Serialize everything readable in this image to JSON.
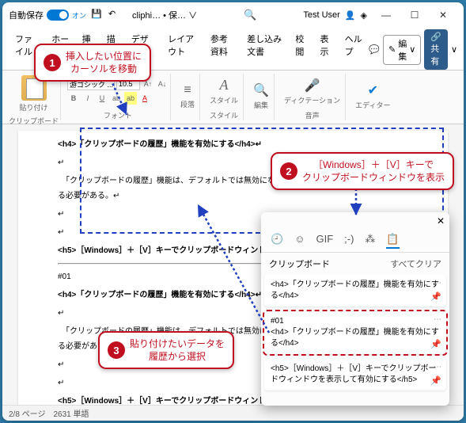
{
  "titlebar": {
    "autosave_label": "自動保存",
    "autosave_on": "オン",
    "doc_title": "cliphi… • 保… ∨",
    "search_placeholder": "",
    "user": "Test User"
  },
  "tabs": {
    "items": [
      "ファイル",
      "ホーム",
      "挿入",
      "描画",
      "デザイン",
      "レイアウト",
      "参考資料",
      "差し込み文書",
      "校閲",
      "表示",
      "ヘルプ"
    ],
    "edit_btn": "編集",
    "share_btn": "共有"
  },
  "ribbon": {
    "clipboard_label": "クリップボード",
    "paste_label": "貼り付け",
    "font_name": "游ゴシック ...",
    "font_size": "10.5",
    "font_label": "フォント",
    "para_label": "段落",
    "style_label": "スタイル",
    "style_btn": "スタイル",
    "edit_label": "編集",
    "dictation_btn": "ディクテーション",
    "voice_label": "音声",
    "editor_btn": "エディター"
  },
  "document": {
    "lines": [
      "<h4>「クリップボードの履歴」機能を有効にする</h4>↵",
      "↵",
      "　「クリップボードの履歴」機能は、デフォルトでは無効になっているので、まず機能を有効にする必要がある。↵",
      "↵",
      "↵",
      "<h5>［Windows］＋［V］キーでクリップボードウィンドウを表示して有効にする</h5>↵",
      "#01",
      "<h4>「クリップボードの履歴」機能を有効にする</h4>↵",
      "↵",
      "　「クリップボードの履歴」機能は、デフォルトでは無効になっているので、まず機能を有効にする必要がある。↵",
      "↵",
      "↵",
      "<h5>［Windows］＋［V］キーでクリップボードウィンドウを表示して有効にする</h5>↵"
    ]
  },
  "statusbar": {
    "page": "2/8 ページ",
    "words": "2631 単語"
  },
  "callouts": {
    "c1_num": "1",
    "c1_text": "挿入したい位置に\nカーソルを移動",
    "c2_num": "2",
    "c2_text": "［Windows］＋［V］キーで\nクリップボードウィンドウを表示",
    "c3_num": "3",
    "c3_text": "貼り付けたいデータを\n履歴から選択"
  },
  "clipboard": {
    "title": "クリップボード",
    "clear_all": "すべてクリア",
    "items": [
      {
        "text": "<h4>「クリップボードの履歴」機能を有効にする</h4>"
      },
      {
        "text_pre": "#01",
        "text": "<h4>「クリップボードの履歴」機能を有効にする</h4>"
      },
      {
        "text": "<h5>［Windows］＋［V］キーでクリップボードウィンドウを表示して有効にする</h5>"
      }
    ]
  }
}
